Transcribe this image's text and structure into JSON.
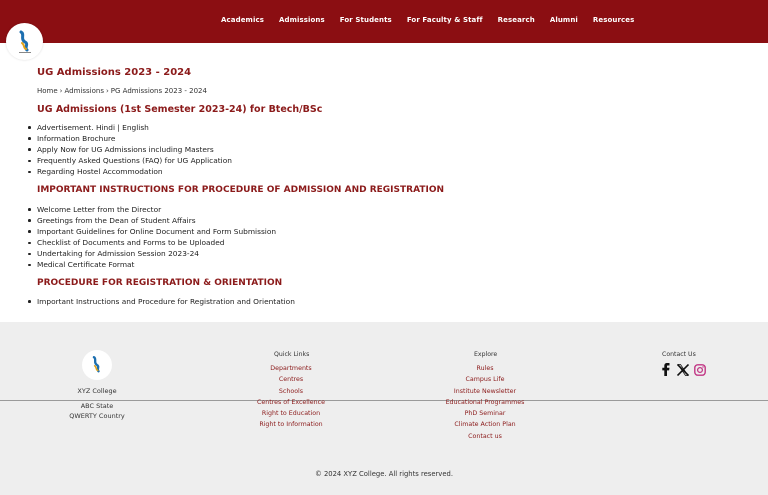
{
  "nav": {
    "items": [
      "Academics",
      "Admissions",
      "For Students",
      "For Faculty & Staff",
      "Research",
      "Alumni",
      "Resources"
    ]
  },
  "page": {
    "title": "UG Admissions 2023 - 2024",
    "breadcrumb": [
      "Home",
      "Admissions",
      "PG Admissions 2023 - 2024"
    ],
    "subheading": "UG Admissions (1st Semester 2023-24) for Btech/BSc",
    "list1": [
      "Advertisement. Hindi | English",
      "Information Brochure",
      "Apply Now for UG Admissions including Masters",
      "Frequently Asked Questions (FAQ) for UG Application",
      "Regarding Hostel Accommodation"
    ],
    "section2_title": "IMPORTANT INSTRUCTIONS FOR PROCEDURE OF ADMISSION AND REGISTRATION",
    "list2": [
      "Welcome Letter from the Director",
      "Greetings from the Dean of Student Affairs",
      "Important Guidelines for Online Document and Form Submission",
      "Checklist of Documents and Forms to be Uploaded",
      "Undertaking for Admission Session 2023-24",
      "Medical Certificate Format"
    ],
    "section3_title": "PROCEDURE FOR REGISTRATION & ORIENTATION",
    "list3": [
      "Important Instructions and Procedure for Registration and Orientation"
    ]
  },
  "footer": {
    "college": "XYZ College",
    "state": "ABC State",
    "country": "QWERTY Country",
    "quick_links_title": "Quick Links",
    "quick_links": [
      "Departments",
      "Centres",
      "Schools",
      "Centres of Excellence",
      "Right to Education",
      "Right to Information"
    ],
    "explore_title": "Explore",
    "explore": [
      "Rules",
      "Campus Life",
      "Institute Newsletter",
      "Educational Programmes",
      "PhD Seminar",
      "Climate Action Plan",
      "Contact us"
    ],
    "contact_title": "Contact Us",
    "social": [
      "facebook-icon",
      "x-icon",
      "instagram-icon"
    ],
    "copyright": "© 2024 XYZ College. All rights reserved."
  },
  "colors": {
    "brand": "#8b0e12",
    "heading": "#8b1a1a",
    "footer_bg": "#eeeeee"
  }
}
